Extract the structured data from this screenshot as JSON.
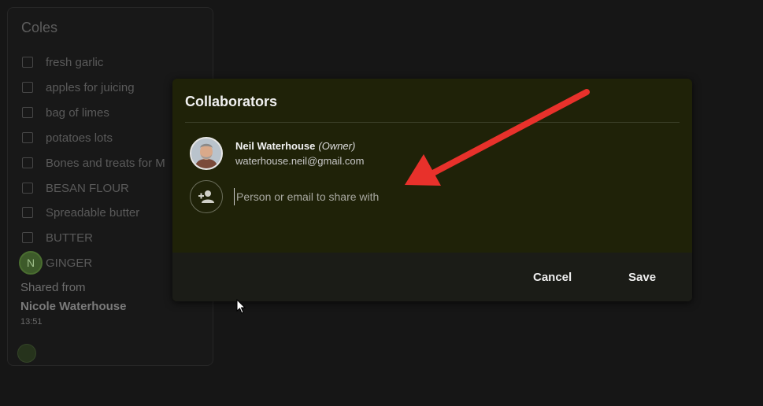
{
  "note": {
    "title": "Coles",
    "items": [
      {
        "label": "fresh garlic"
      },
      {
        "label": "apples for juicing"
      },
      {
        "label": "bag of limes"
      },
      {
        "label": "potatoes lots"
      },
      {
        "label": "Bones and treats for M"
      },
      {
        "label": "BESAN FLOUR"
      },
      {
        "label": "Spreadable butter"
      },
      {
        "label": "BUTTER"
      },
      {
        "label": "GINGER"
      }
    ],
    "avatar_letter": "N",
    "shared_from": "Shared from",
    "shared_name": "Nicole Waterhouse",
    "time": "13:51"
  },
  "dialog": {
    "title": "Collaborators",
    "owner": {
      "name": "Neil Waterhouse",
      "role": "(Owner)",
      "email": "waterhouse.neil@gmail.com",
      "avatar_icon": "profile-photo"
    },
    "share_input": {
      "value": "",
      "placeholder": "Person or email to share with",
      "icon": "person-add-icon"
    },
    "buttons": {
      "cancel": "Cancel",
      "save": "Save"
    }
  },
  "colors": {
    "dialog_bg": "#1f2208",
    "arrow": "#e8312b",
    "backdrop": "#161616"
  }
}
